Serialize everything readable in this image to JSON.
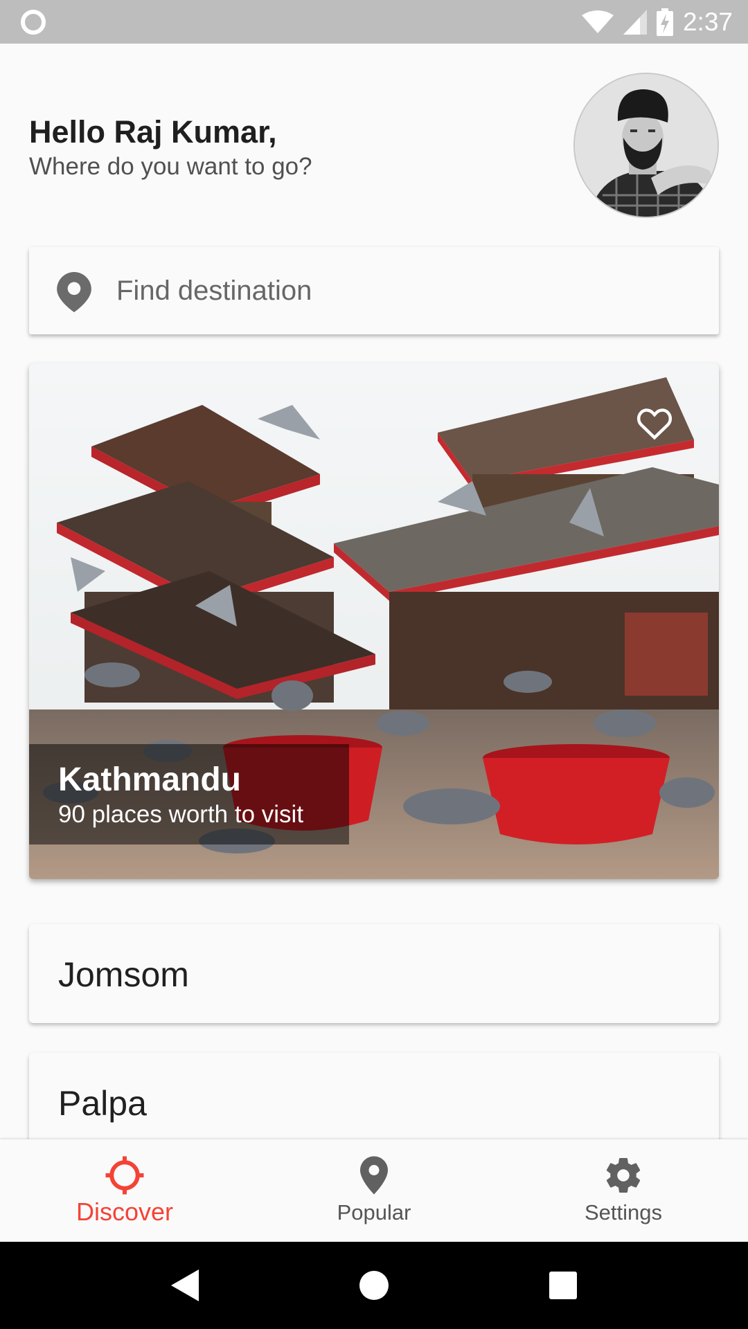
{
  "status_bar": {
    "time": "2:37"
  },
  "header": {
    "title": "Hello Raj Kumar,",
    "subtitle": "Where do you want to go?"
  },
  "search": {
    "placeholder": "Find destination"
  },
  "featured": {
    "title": "Kathmandu",
    "subtitle": "90 places worth to visit"
  },
  "destinations": [
    {
      "name": "Jomsom"
    },
    {
      "name": "Palpa"
    }
  ],
  "bottom_nav": {
    "items": [
      {
        "label": "Discover",
        "icon": "crosshair-icon",
        "active": true
      },
      {
        "label": "Popular",
        "icon": "location-pin-icon",
        "active": false
      },
      {
        "label": "Settings",
        "icon": "gear-icon",
        "active": false
      }
    ]
  },
  "colors": {
    "accent": "#f44336",
    "inactive": "#555555"
  }
}
